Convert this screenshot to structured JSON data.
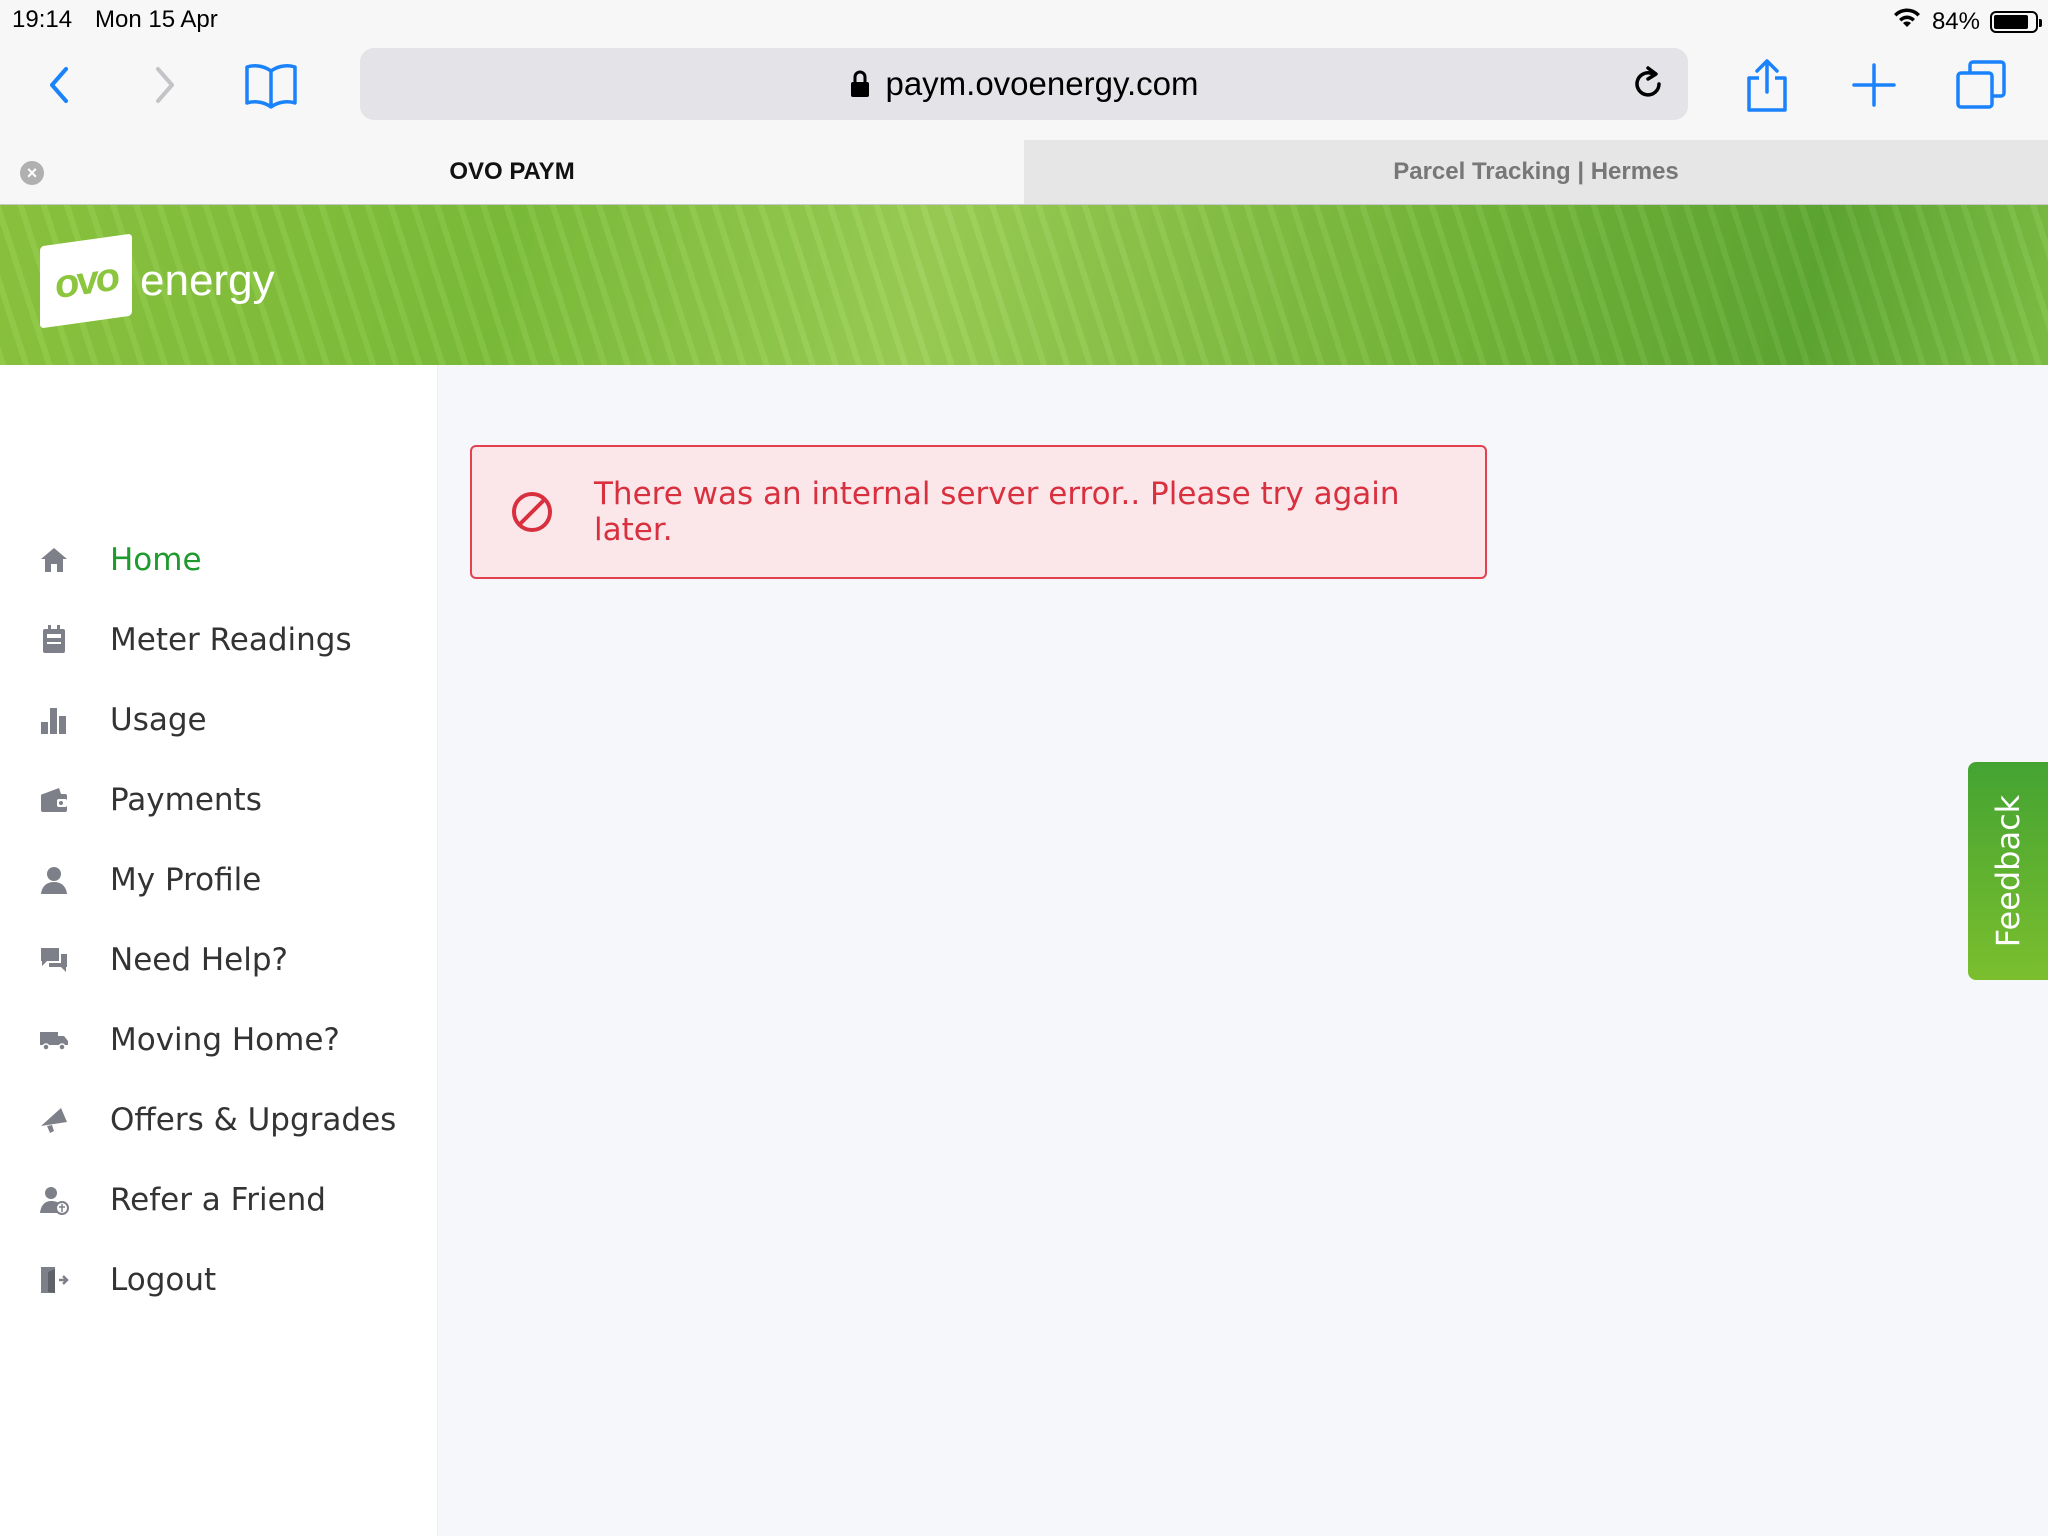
{
  "status_bar": {
    "time": "19:14",
    "date": "Mon 15 Apr",
    "battery": "84%",
    "battery_level": 0.84
  },
  "browser": {
    "url": "paym.ovoenergy.com",
    "icons": {
      "back": "chevron-left-icon",
      "forward": "chevron-right-icon",
      "bookmarks": "book-icon",
      "lock": "lock-icon",
      "reload": "reload-icon",
      "share": "share-icon",
      "new_tab": "plus-icon",
      "tabs": "tabs-icon"
    },
    "accent_color": "#1a82fb",
    "tabs": [
      {
        "title": "OVO PAYM",
        "active": true
      },
      {
        "title": "Parcel Tracking | Hermes",
        "active": false
      }
    ]
  },
  "header": {
    "logo_mark": "ovo",
    "logo_text": "energy",
    "banner_color": "#8cc63f"
  },
  "sidebar": {
    "active_color": "#1f9a2e",
    "items": [
      {
        "label": "Home",
        "icon": "home-icon",
        "active": true
      },
      {
        "label": "Meter Readings",
        "icon": "meter-icon",
        "active": false
      },
      {
        "label": "Usage",
        "icon": "bar-chart-icon",
        "active": false
      },
      {
        "label": "Payments",
        "icon": "wallet-icon",
        "active": false
      },
      {
        "label": "My Profile",
        "icon": "user-icon",
        "active": false
      },
      {
        "label": "Need Help?",
        "icon": "chat-icon",
        "active": false
      },
      {
        "label": "Moving Home?",
        "icon": "van-icon",
        "active": false
      },
      {
        "label": "Offers & Upgrades",
        "icon": "megaphone-icon",
        "active": false
      },
      {
        "label": "Refer a Friend",
        "icon": "refer-friend-icon",
        "active": false
      },
      {
        "label": "Logout",
        "icon": "logout-icon",
        "active": false
      }
    ]
  },
  "alert": {
    "message": "There was an internal server error.. Please try again later.",
    "icon": "prohibited-icon",
    "color": "#d9303f"
  },
  "feedback": {
    "label": "Feedback"
  }
}
